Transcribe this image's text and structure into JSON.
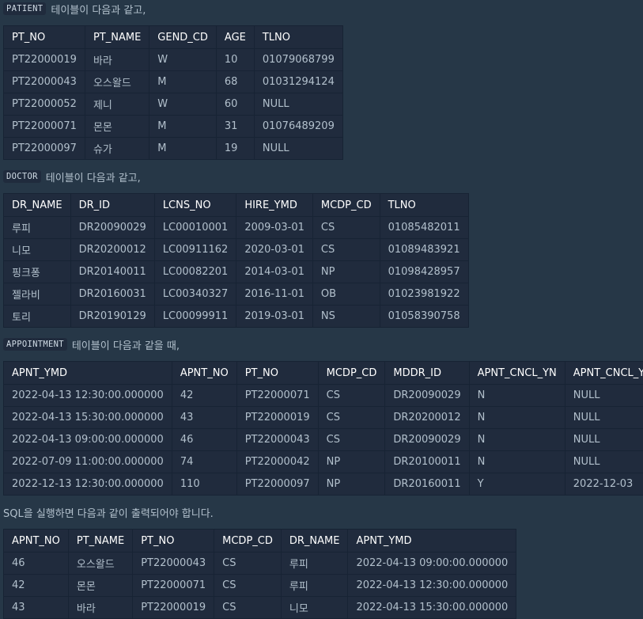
{
  "patient_label": "PATIENT",
  "patient_text": "테이블이 다음과 같고,",
  "patient_table": {
    "headers": [
      "PT_NO",
      "PT_NAME",
      "GEND_CD",
      "AGE",
      "TLNO"
    ],
    "rows": [
      [
        "PT22000019",
        "바라",
        "W",
        "10",
        "01079068799"
      ],
      [
        "PT22000043",
        "오스왈드",
        "M",
        "68",
        "01031294124"
      ],
      [
        "PT22000052",
        "제니",
        "W",
        "60",
        "NULL"
      ],
      [
        "PT22000071",
        "몬몬",
        "M",
        "31",
        "01076489209"
      ],
      [
        "PT22000097",
        "슈가",
        "M",
        "19",
        "NULL"
      ]
    ]
  },
  "doctor_label": "DOCTOR",
  "doctor_text": "테이블이 다음과 같고,",
  "doctor_table": {
    "headers": [
      "DR_NAME",
      "DR_ID",
      "LCNS_NO",
      "HIRE_YMD",
      "MCDP_CD",
      "TLNO"
    ],
    "rows": [
      [
        "루피",
        "DR20090029",
        "LC00010001",
        "2009-03-01",
        "CS",
        "01085482011"
      ],
      [
        "니모",
        "DR20200012",
        "LC00911162",
        "2020-03-01",
        "CS",
        "01089483921"
      ],
      [
        "핑크퐁",
        "DR20140011",
        "LC00082201",
        "2014-03-01",
        "NP",
        "01098428957"
      ],
      [
        "젤라비",
        "DR20160031",
        "LC00340327",
        "2016-11-01",
        "OB",
        "01023981922"
      ],
      [
        "토리",
        "DR20190129",
        "LC00099911",
        "2019-03-01",
        "NS",
        "01058390758"
      ]
    ]
  },
  "appointment_label": "APPOINTMENT",
  "appointment_text": "테이블이 다음과 같을 때,",
  "appointment_table": {
    "headers": [
      "APNT_YMD",
      "APNT_NO",
      "PT_NO",
      "MCDP_CD",
      "MDDR_ID",
      "APNT_CNCL_YN",
      "APNT_CNCL_YMD"
    ],
    "rows": [
      [
        "2022-04-13 12:30:00.000000",
        "42",
        "PT22000071",
        "CS",
        "DR20090029",
        "N",
        "NULL"
      ],
      [
        "2022-04-13 15:30:00.000000",
        "43",
        "PT22000019",
        "CS",
        "DR20200012",
        "N",
        "NULL"
      ],
      [
        "2022-04-13 09:00:00.000000",
        "46",
        "PT22000043",
        "CS",
        "DR20090029",
        "N",
        "NULL"
      ],
      [
        "2022-07-09 11:00:00.000000",
        "74",
        "PT22000042",
        "NP",
        "DR20100011",
        "N",
        "NULL"
      ],
      [
        "2022-12-13 12:30:00.000000",
        "110",
        "PT22000097",
        "NP",
        "DR20160011",
        "Y",
        "2022-12-03"
      ]
    ]
  },
  "result_text": "SQL을 실행하면 다음과 같이 출력되어야 합니다.",
  "result_table": {
    "headers": [
      "APNT_NO",
      "PT_NAME",
      "PT_NO",
      "MCDP_CD",
      "DR_NAME",
      "APNT_YMD"
    ],
    "rows": [
      [
        "46",
        "오스왈드",
        "PT22000043",
        "CS",
        "루피",
        "2022-04-13 09:00:00.000000"
      ],
      [
        "42",
        "몬몬",
        "PT22000071",
        "CS",
        "루피",
        "2022-04-13 12:30:00.000000"
      ],
      [
        "43",
        "바라",
        "PT22000019",
        "CS",
        "니모",
        "2022-04-13 15:30:00.000000"
      ]
    ]
  }
}
